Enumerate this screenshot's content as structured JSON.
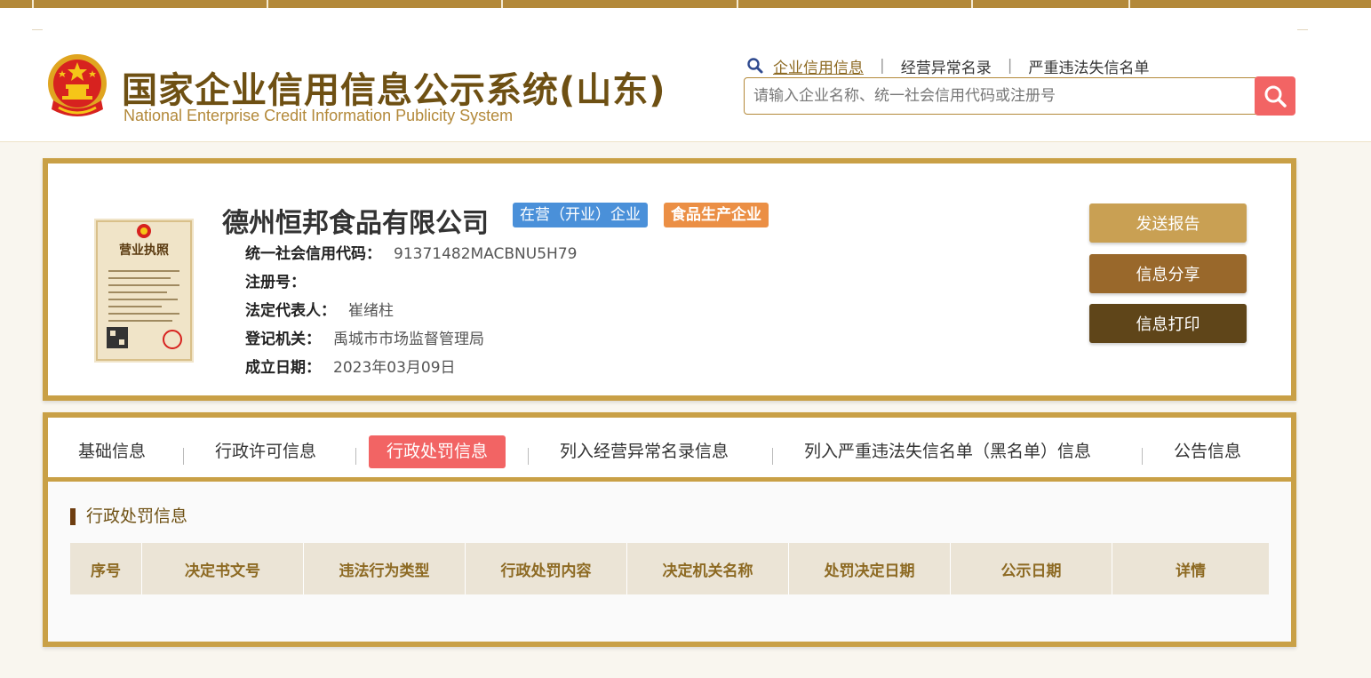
{
  "header": {
    "title_cn": "国家企业信用信息公示系统(山东)",
    "title_en": "National Enterprise Credit Information Publicity System",
    "links": [
      "企业信用信息",
      "经营异常名录",
      "严重违法失信名单"
    ],
    "link_separator": "|",
    "search_placeholder": "请输入企业名称、统一社会信用代码或注册号",
    "icons": {
      "links": "search-icon",
      "search_button": "magnifier-icon"
    }
  },
  "company": {
    "name": "德州恒邦食品有限公司",
    "status_tag": "在营（开业）企业",
    "type_tag": "食品生产企业",
    "license_image_text": "营业执照",
    "fields": [
      {
        "label": "统一社会信用代码：",
        "value": "91371482MACBNU5H79"
      },
      {
        "label": "注册号：",
        "value": ""
      },
      {
        "label": "法定代表人：",
        "value": "崔绪柱"
      },
      {
        "label": "登记机关：",
        "value": "禹城市市场监督管理局"
      },
      {
        "label": "成立日期：",
        "value": "2023年03月09日"
      }
    ]
  },
  "actions": {
    "send_report": "发送报告",
    "share": "信息分享",
    "print": "信息打印"
  },
  "tabs": [
    {
      "label": "基础信息",
      "active": false
    },
    {
      "label": "行政许可信息",
      "active": false
    },
    {
      "label": "行政处罚信息",
      "active": true
    },
    {
      "label": "列入经营异常名录信息",
      "active": false
    },
    {
      "label": "列入严重违法失信名单（黑名单）信息",
      "active": false
    },
    {
      "label": "公告信息",
      "active": false
    }
  ],
  "penalty_section": {
    "title": "行政处罚信息",
    "columns": [
      "序号",
      "决定书文号",
      "违法行为类型",
      "行政处罚内容",
      "决定机关名称",
      "处罚决定日期",
      "公示日期",
      "详情"
    ]
  },
  "colors": {
    "gold": "#c9a046",
    "brown_text": "#6e5013",
    "active_red": "#f26464",
    "status_blue": "#4a90d9",
    "type_orange": "#eb8f45"
  }
}
